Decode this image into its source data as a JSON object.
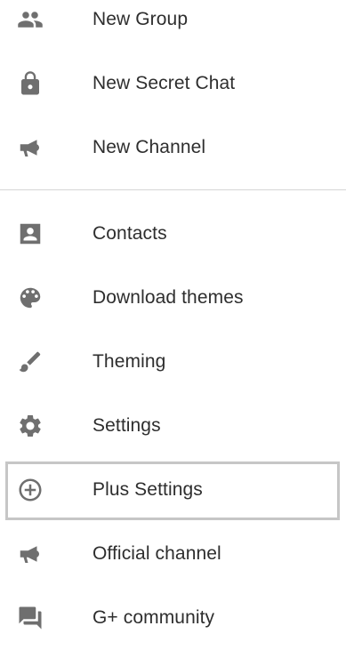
{
  "menu": {
    "items": [
      {
        "label": "New Group",
        "icon": "group-icon"
      },
      {
        "label": "New Secret Chat",
        "icon": "lock-icon"
      },
      {
        "label": "New Channel",
        "icon": "megaphone-icon"
      },
      {
        "label": "Contacts",
        "icon": "contact-card-icon"
      },
      {
        "label": "Download themes",
        "icon": "palette-icon"
      },
      {
        "label": "Theming",
        "icon": "brush-icon"
      },
      {
        "label": "Settings",
        "icon": "gear-icon"
      },
      {
        "label": "Plus Settings",
        "icon": "add-circle-icon"
      },
      {
        "label": "Official channel",
        "icon": "megaphone-icon"
      },
      {
        "label": "G+ community",
        "icon": "forum-icon"
      }
    ],
    "highlighted_item": "Plus Settings"
  },
  "colors": {
    "icon": "#6f6f6f",
    "text": "#2e2e2e",
    "divider": "#d6d6d6",
    "highlight_border": "#c6c6c6"
  }
}
